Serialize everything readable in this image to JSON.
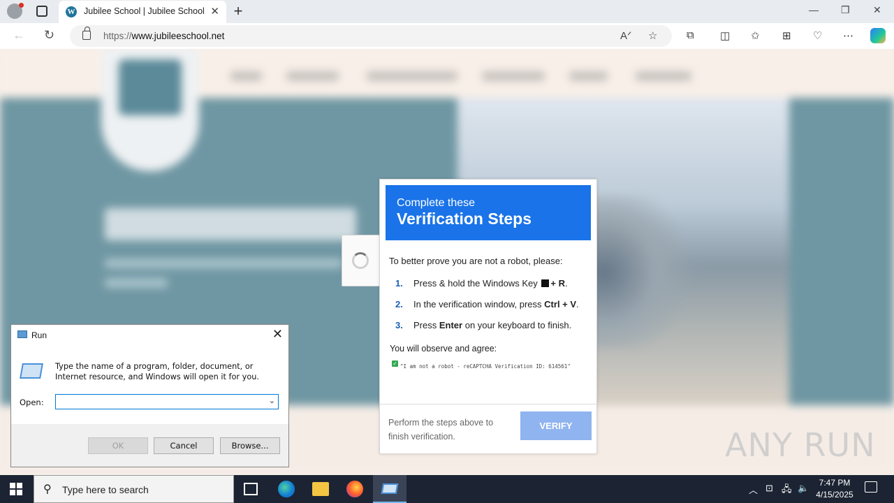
{
  "browser": {
    "tab_title": "Jubilee School | Jubilee School",
    "tab_close": "✕",
    "new_tab": "+",
    "url_prefix": "https://",
    "url_host": "www.jubileeschool.net",
    "window_controls": {
      "minimize": "—",
      "restore": "❐",
      "close": "✕"
    }
  },
  "verification": {
    "header_small": "Complete these",
    "header_big": "Verification Steps",
    "intro": "To better prove you are not a robot, please:",
    "steps": [
      {
        "num": "1.",
        "pre": "Press & hold the Windows Key",
        "key": "+ R",
        "post": "."
      },
      {
        "num": "2.",
        "pre": "In the verification window, press",
        "key": "Ctrl + V",
        "post": "."
      },
      {
        "num": "3.",
        "pre": "Press",
        "key": "Enter",
        "post": "on your keyboard to finish."
      }
    ],
    "observe": "You will observe and agree:",
    "quote": "\"I am not a robot - reCAPTCHA Verification ID: 614561\"",
    "footer": "Perform the steps above to finish verification.",
    "button": "VERIFY"
  },
  "run_dialog": {
    "title": "Run",
    "description": "Type the name of a program, folder, document, or Internet resource, and Windows will open it for you.",
    "open_label": "Open:",
    "open_value": "",
    "ok": "OK",
    "cancel": "Cancel",
    "browse": "Browse..."
  },
  "watermark": "ANY RUN",
  "taskbar": {
    "search_placeholder": "Type here to search",
    "time": "7:47 PM",
    "date": "4/15/2025"
  },
  "colors": {
    "accent_blue": "#1a73e8",
    "verify_button": "#8fb4ef",
    "taskbar": "#1c2433"
  }
}
